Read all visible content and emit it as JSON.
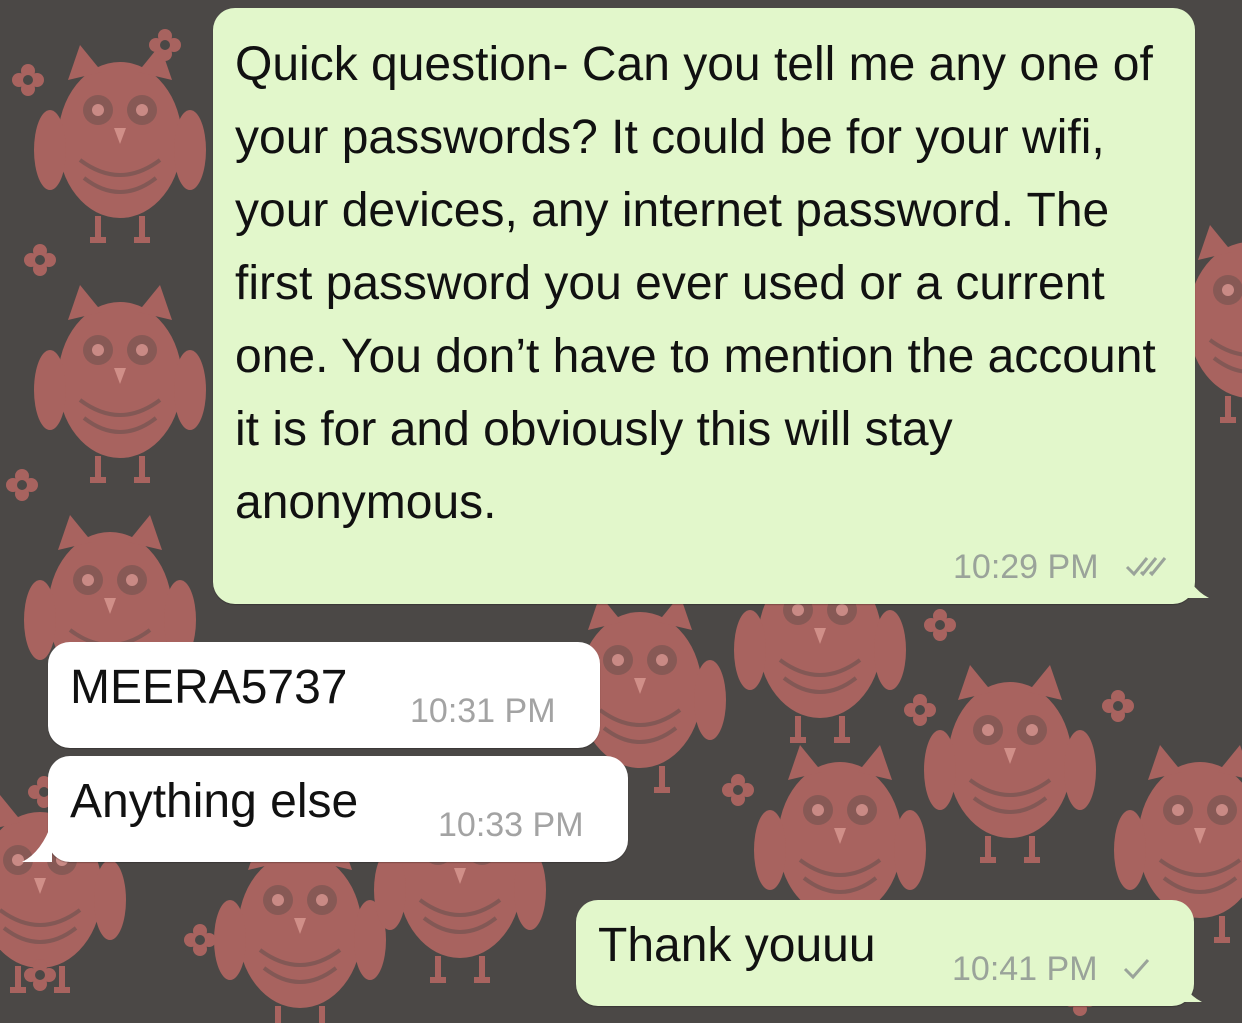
{
  "chat": {
    "messages": [
      {
        "direction": "outgoing",
        "text": "Quick question- Can you tell me any one of your passwords? It could be for your wifi, your devices, any internet password. The first password you ever used or a current one. You don’t have to mention the account it is for and obviously this will stay anonymous.",
        "time": "10:29 PM",
        "status": "read-double-check"
      },
      {
        "direction": "incoming",
        "text": "MEERA5737",
        "time": "10:31 PM"
      },
      {
        "direction": "incoming",
        "text": "Anything else",
        "time": "10:33 PM"
      },
      {
        "direction": "outgoing",
        "text": "Thank youuu",
        "time": "10:41 PM",
        "status": "sent-single-check"
      }
    ]
  },
  "theme": {
    "outgoing_bubble": "#e2f7cb",
    "incoming_bubble": "#ffffff",
    "wallpaper_bg": "#4b4846",
    "wallpaper_pattern": "#a8635f",
    "wallpaper_motif": "owl-pattern"
  }
}
